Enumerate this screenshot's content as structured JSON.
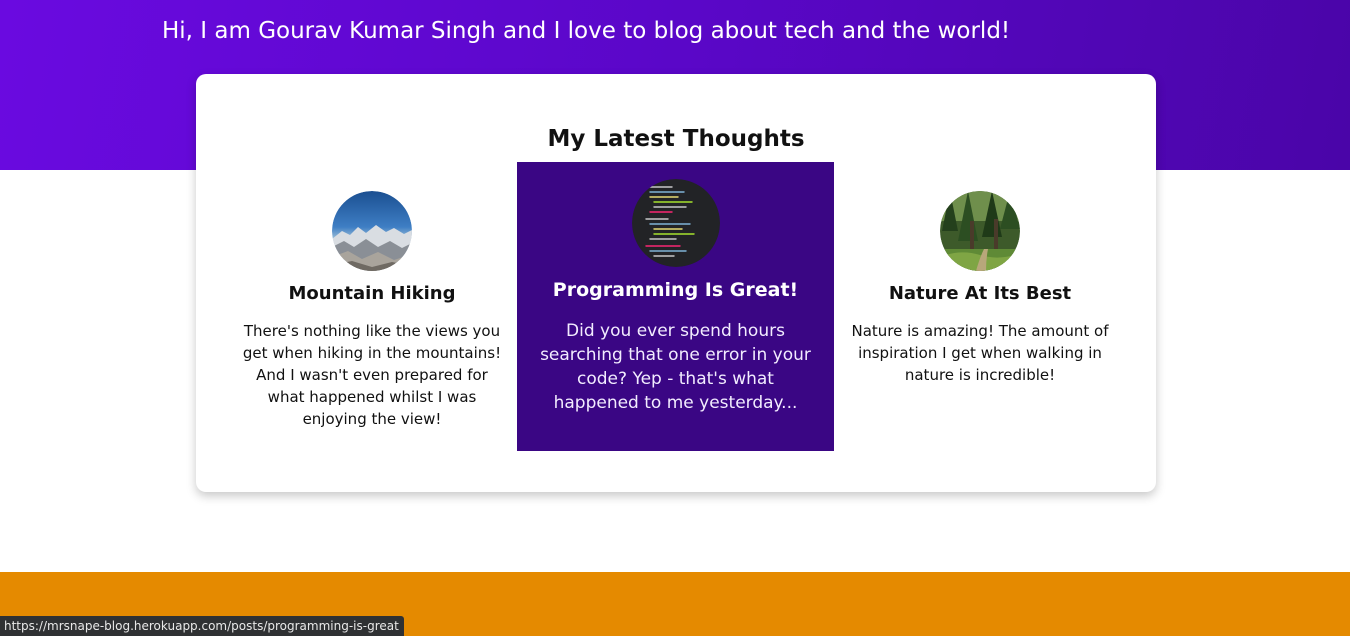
{
  "hero": {
    "intro": "Hi, I am Gourav Kumar Singh and I love to blog about tech and the world!"
  },
  "latest": {
    "heading": "My Latest Thoughts",
    "posts": [
      {
        "title": "Mountain Hiking",
        "excerpt": "There's nothing like the views you get when hiking in the mountains! And I wasn't even prepared for what happened whilst I was enjoying the view!",
        "image": "mountain-photo"
      },
      {
        "title": "Programming Is Great!",
        "excerpt": "Did you ever spend hours searching that one error in your code? Yep - that's what happened to me yesterday...",
        "image": "code-photo",
        "state": "hovered"
      },
      {
        "title": "Nature At Its Best",
        "excerpt": "Nature is amazing! The amount of inspiration I get when walking in nature is incredible!",
        "image": "forest-photo"
      }
    ]
  },
  "status_bar": {
    "url": "https://mrsnape-blog.herokuapp.com/posts/programming-is-great"
  },
  "colors": {
    "hero_start": "#6a0ae0",
    "hero_end": "#4a05a8",
    "hover_card": "#3a0684",
    "footer": "#e58a00"
  }
}
